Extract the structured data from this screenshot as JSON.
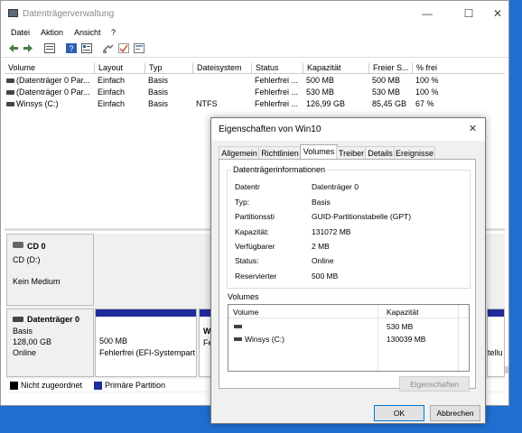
{
  "window": {
    "title": "Datenträgerverwaltung",
    "minimize_glyph": "—",
    "maximize_glyph": "☐",
    "close_glyph": "✕"
  },
  "menu": [
    "Datei",
    "Aktion",
    "Ansicht",
    "?"
  ],
  "toolbar_icons": [
    "back-icon",
    "forward-icon",
    "list-view-icon",
    "help-icon",
    "properties-icon",
    "connect-icon",
    "check-icon",
    "settings-icon"
  ],
  "volume_table": {
    "headers": [
      "Volume",
      "Layout",
      "Typ",
      "Dateisystem",
      "Status",
      "Kapazität",
      "Freier S...",
      "% frei"
    ],
    "rows": [
      [
        "(Datenträger 0 Par...",
        "Einfach",
        "Basis",
        "",
        "Fehlerfrei ...",
        "500 MB",
        "500 MB",
        "100 %"
      ],
      [
        "(Datenträger 0 Par...",
        "Einfach",
        "Basis",
        "",
        "Fehlerfrei ...",
        "530 MB",
        "530 MB",
        "100 %"
      ],
      [
        "Winsys (C:)",
        "Einfach",
        "Basis",
        "NTFS",
        "Fehlerfrei ...",
        "126,99 GB",
        "85,45 GB",
        "67 %"
      ]
    ]
  },
  "cd_panel": {
    "name": "CD 0",
    "drive": "CD (D:)",
    "media": "Kein Medium"
  },
  "disk_panel": {
    "name": "Datenträger 0",
    "type": "Basis",
    "size": "128,00 GB",
    "status": "Online",
    "partition1_size": "500 MB",
    "partition1_status": "Fehlerfrei (EFI-Systempart",
    "partition2_size": "W",
    "partition2_status": "Fe",
    "partition_right_text": "tellu"
  },
  "legend": {
    "unassigned": "Nicht zugeordnet",
    "primary": "Primäre Partition",
    "unassigned_color": "#000000",
    "primary_color": "#1f2c9c"
  },
  "dialog": {
    "title": "Eigenschaften von Win10",
    "close_glyph": "✕",
    "tabs": [
      "Allgemein",
      "Richtlinien",
      "Volumes",
      "Treiber",
      "Details",
      "Ereignisse"
    ],
    "selected_tab": "Volumes",
    "info_group_title": "Datenträgerinformationen",
    "info": [
      {
        "label": "Datentr",
        "value": "Datenträger 0"
      },
      {
        "label": "Typ:",
        "value": "Basis"
      },
      {
        "label": "Partitionssti",
        "value": "GUID-Partitionstabelle (GPT)"
      },
      {
        "label": "Kapazität:",
        "value": "131072 MB"
      },
      {
        "label": "Verfügbarer",
        "value": "2 MB"
      },
      {
        "label": "Status:",
        "value": "Online"
      },
      {
        "label": "Reservierter",
        "value": "500 MB"
      }
    ],
    "volumes_label": "Volumes",
    "volumes_headers": [
      "Volume",
      "Kapazität"
    ],
    "volumes_rows": [
      {
        "name": "",
        "capacity": "530 MB"
      },
      {
        "name": "Winsys (C:)",
        "capacity": "130039 MB"
      }
    ],
    "properties_button": "Eigenschaften",
    "ok_button": "OK",
    "cancel_button": "Abbrechen"
  },
  "desktop_edge_text": "s"
}
